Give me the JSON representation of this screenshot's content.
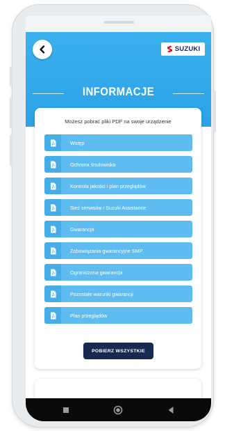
{
  "header": {
    "title": "INFORMACJE",
    "back_icon": "chevron-left-icon",
    "logo_text": "SUZUKI",
    "logo_icon": "suzuki-s-icon",
    "logo_color": "#e30613",
    "header_color": "#37aef0"
  },
  "card": {
    "subtitle": "Możesz pobrać pliki PDF na swoje urządzenie",
    "documents": [
      {
        "label": "Wstęp",
        "icon": "pdf-icon"
      },
      {
        "label": "Ochrona środowiska",
        "icon": "pdf-icon"
      },
      {
        "label": "Kontrola jakości i plan przeglądów",
        "icon": "pdf-icon"
      },
      {
        "label": "Sieć serwisów i Suzuki Assistance",
        "icon": "pdf-icon"
      },
      {
        "label": "Gwarancja",
        "icon": "pdf-icon"
      },
      {
        "label": "Zobowiązania gwarancyjne SMP",
        "icon": "pdf-icon"
      },
      {
        "label": "Ograniczona gwarancja",
        "icon": "pdf-icon"
      },
      {
        "label": "Pozostałe warunki gwarancji",
        "icon": "pdf-icon"
      },
      {
        "label": "Plan przeglądów",
        "icon": "pdf-icon"
      }
    ],
    "download_all_label": "POBIERZ WSZYSTKIE",
    "button_color": "#182a50",
    "doc_color": "#5ebcf0"
  },
  "navbar": {
    "recent_icon": "square-icon",
    "home_icon": "circle-home-icon",
    "back_icon": "triangle-back-icon"
  }
}
